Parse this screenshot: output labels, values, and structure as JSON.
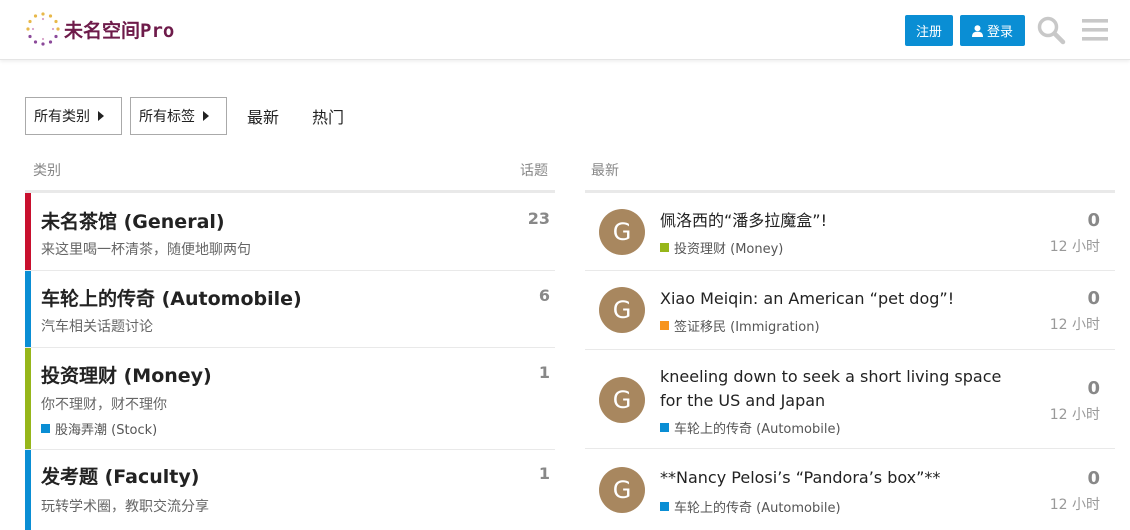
{
  "site": {
    "title": "未名空间Pro"
  },
  "header": {
    "signup_label": "注册",
    "login_label": "登录"
  },
  "nav": {
    "all_categories": "所有类别",
    "all_tags": "所有标签",
    "latest": "最新",
    "top": "热门"
  },
  "categories_column": {
    "label": "类别",
    "topics_label": "话题"
  },
  "latest_column": {
    "label": "最新"
  },
  "categories": [
    {
      "name": "未名茶馆 (General)",
      "description": "来这里喝一杯清茶，随便地聊两句",
      "topics": "23",
      "color": "#c8102e"
    },
    {
      "name": "车轮上的传奇 (Automobile)",
      "description": "汽车相关话题讨论",
      "topics": "6",
      "color": "#0a8ed4"
    },
    {
      "name": "投资理财 (Money)",
      "description": "你不理财，财不理你",
      "topics": "1",
      "color": "#96b61a",
      "subcategory": {
        "name": "股海弄潮 (Stock)",
        "color": "#0a8ed4"
      }
    },
    {
      "name": "发考题 (Faculty)",
      "description": "玩转学术圈，教职交流分享",
      "topics": "1",
      "color": "#0a8ed4"
    }
  ],
  "topics": [
    {
      "avatar_letter": "G",
      "title": "佩洛西的“潘多拉魔盒”!",
      "category": "投资理财 (Money)",
      "category_color": "#96b61a",
      "posts": "0",
      "age": "12 小时"
    },
    {
      "avatar_letter": "G",
      "title": "Xiao Meiqin: an American “pet dog”!",
      "category": "签证移民 (Immigration)",
      "category_color": "#f7941d",
      "posts": "0",
      "age": "12 小时"
    },
    {
      "avatar_letter": "G",
      "title": "kneeling down to seek a short living space for the US and Japan",
      "category": "车轮上的传奇 (Automobile)",
      "category_color": "#0a8ed4",
      "posts": "0",
      "age": "12 小时"
    },
    {
      "avatar_letter": "G",
      "title": "**Nancy Pelosi’s “Pandora’s box”**",
      "category": "车轮上的传奇 (Automobile)",
      "category_color": "#0a8ed4",
      "posts": "0",
      "age": "12 小时"
    }
  ],
  "icons": {
    "logo": "logo-icon",
    "user": "user-icon",
    "search": "search-icon",
    "menu": "hamburger-menu-icon",
    "caret": "caret-right-icon"
  }
}
